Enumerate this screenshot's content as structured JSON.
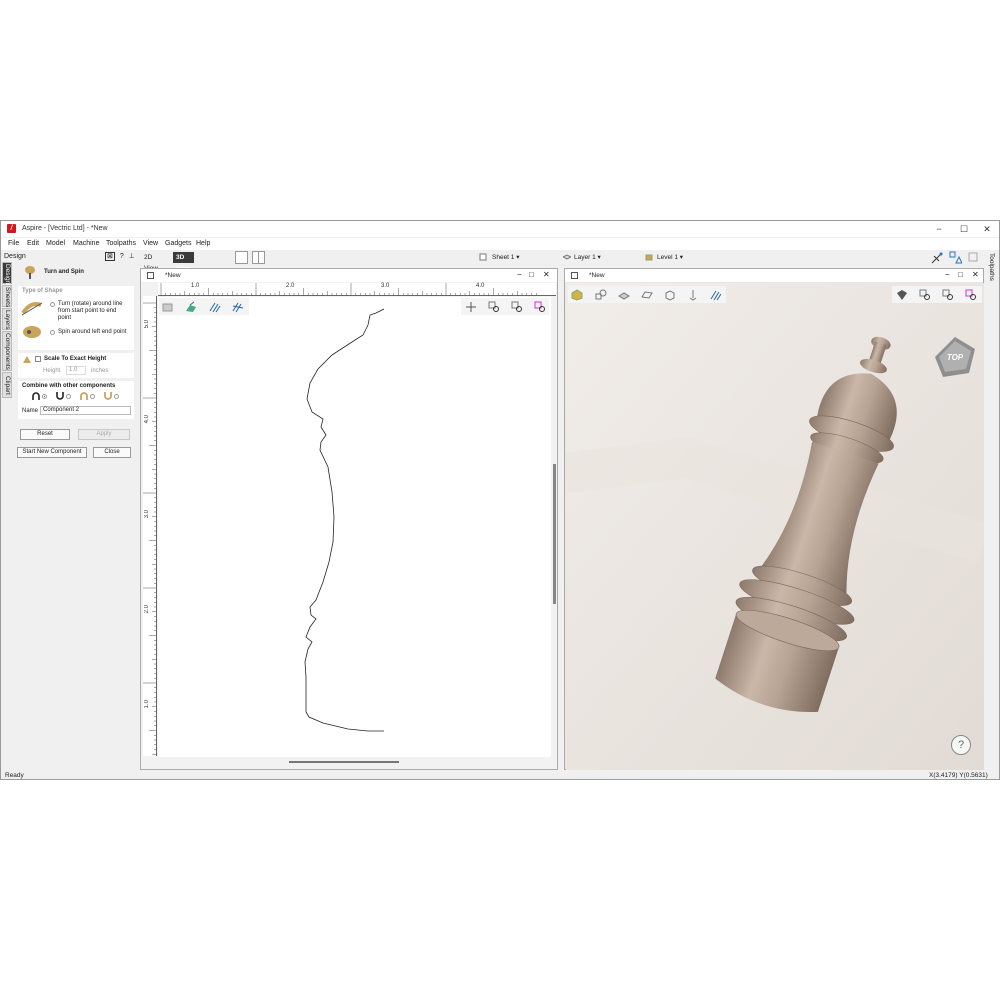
{
  "window": {
    "title": "Aspire - [Vectric Ltd] - *New",
    "logo_letter": "/",
    "minimize": "−",
    "maximize": "☐",
    "close": "✕"
  },
  "menu": [
    "File",
    "Edit",
    "Model",
    "Machine",
    "Toolpaths",
    "View",
    "Gadgets",
    "Help"
  ],
  "left_panel": {
    "title": "Design",
    "header_icons": [
      "⊠",
      "?",
      "⊥"
    ],
    "tabs": [
      "Design",
      "Sheets",
      "Layers",
      "Components",
      "Clipart"
    ],
    "tool_title": "Turn and Spin",
    "type_of_shape": {
      "heading": "Type of Shape",
      "option1": "Turn (rotate) around line from start point to end point",
      "option2": "Spin around left end point"
    },
    "scale": {
      "label": "Scale To Exact Height",
      "height_label": "Height",
      "height_value": "1.0",
      "units": "inches"
    },
    "combine": {
      "heading": "Combine with other components",
      "name_label": "Name",
      "name_value": "Component 2"
    },
    "buttons": {
      "reset": "Reset",
      "apply": "Apply",
      "start_new": "Start New Component",
      "close": "Close"
    }
  },
  "view_tabs": {
    "view2d": "2D View",
    "view3d": "3D View"
  },
  "topbar": {
    "sheet": "Sheet 1",
    "layer": "Layer 1",
    "level": "Level 1"
  },
  "views": {
    "left_title": "*New",
    "right_title": "*New",
    "ruler_h": [
      "1.0",
      "2.0",
      "3.0",
      "4.0"
    ],
    "ruler_v": [
      "5.0",
      "4.0",
      "3.0",
      "2.0",
      "1.0"
    ]
  },
  "view_cube_label": "TOP",
  "help_label": "?",
  "right_panel_tab": "Toolpaths",
  "status": {
    "left": "Ready",
    "right": "X(3.4179) Y(0.5631)"
  },
  "colors": {
    "wood": "#b8a597",
    "wood_dark": "#8a786b",
    "bg3d": "#ebe6e2",
    "accent_red": "#d0181e"
  }
}
